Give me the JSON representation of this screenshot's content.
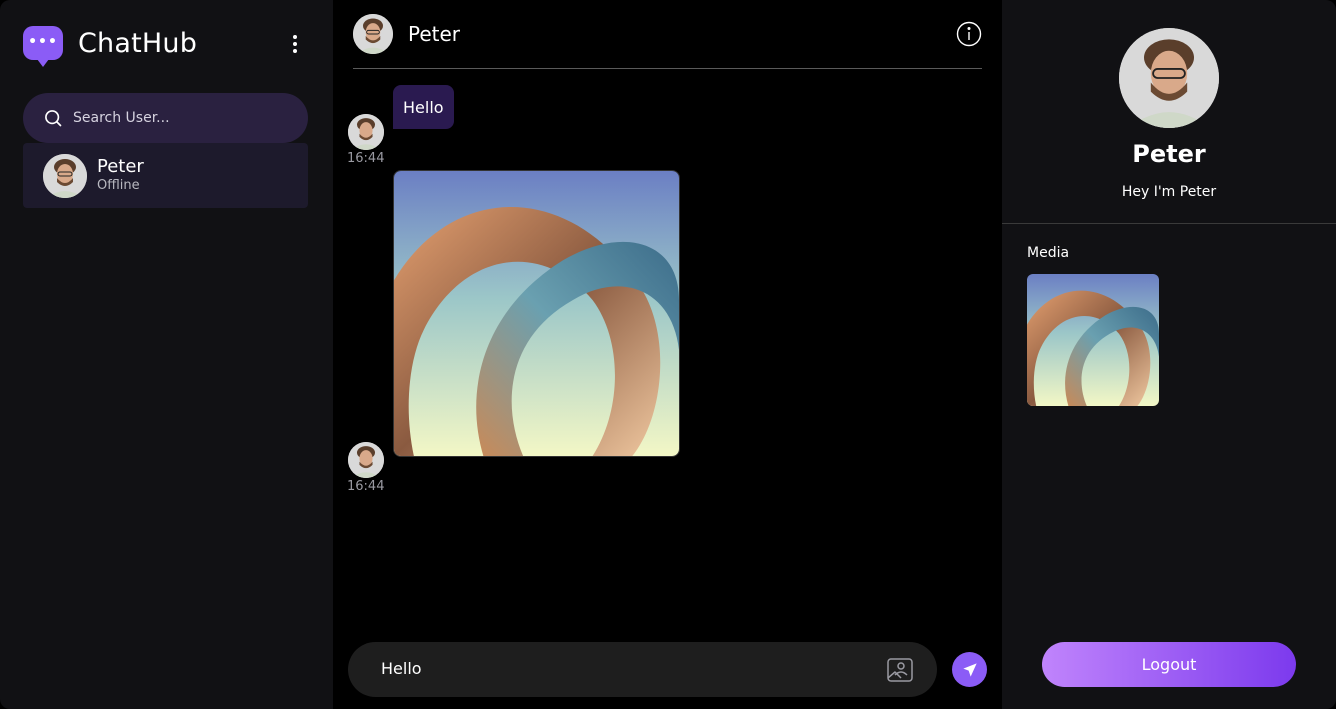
{
  "app": {
    "name": "ChatHub"
  },
  "sidebar": {
    "search": {
      "placeholder": "Search User..."
    },
    "users": [
      {
        "name": "Peter",
        "status": "Offline"
      }
    ]
  },
  "chat": {
    "title": "Peter",
    "messages": [
      {
        "type": "text",
        "text": "Hello",
        "time": "16:44"
      },
      {
        "type": "image",
        "time": "16:44"
      }
    ],
    "composer": {
      "value": "Hello"
    }
  },
  "profile": {
    "name": "Peter",
    "bio": "Hey I'm Peter",
    "media_title": "Media",
    "logout_label": "Logout"
  },
  "colors": {
    "accent": "#8b5cf6",
    "panel": "#111114",
    "bubble": "#2a1a50",
    "search_bg": "#2a2140"
  },
  "icons": [
    "chat-logo-icon",
    "more-vertical-icon",
    "search-icon",
    "info-icon",
    "image-upload-icon",
    "send-icon"
  ]
}
